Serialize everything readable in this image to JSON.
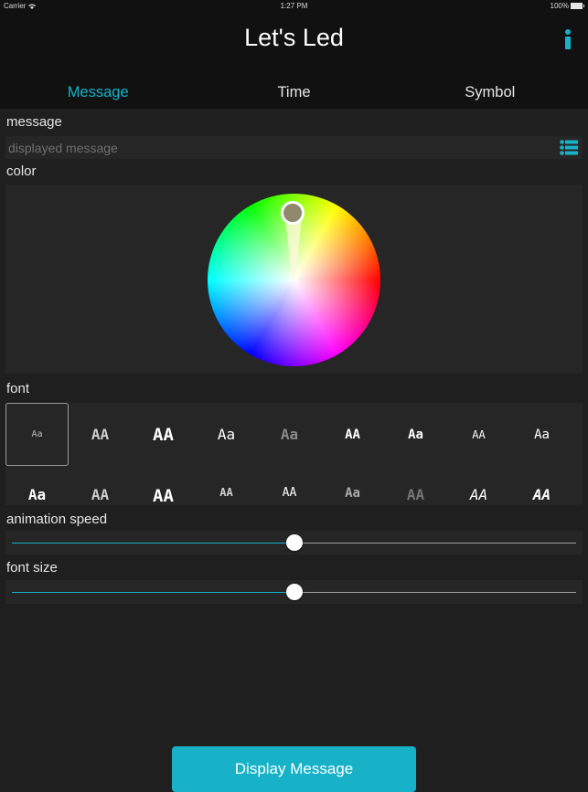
{
  "status_bar": {
    "carrier": "Carrier",
    "time": "1:27 PM",
    "battery": "100%"
  },
  "header": {
    "title": "Let's Led",
    "info_icon": "info-icon"
  },
  "tabs": [
    {
      "label": "Message",
      "active": true
    },
    {
      "label": "Time",
      "active": false
    },
    {
      "label": "Symbol",
      "active": false
    }
  ],
  "message": {
    "label": "message",
    "value": "",
    "placeholder": "displayed message",
    "list_icon": "list-icon"
  },
  "color": {
    "label": "color",
    "selected_color": "#8f8a6e"
  },
  "font": {
    "label": "font",
    "selected_index": 0,
    "row1": [
      "Aa",
      "AA",
      "AA",
      "Aa",
      "Aa",
      "AA",
      "Aa",
      "AA",
      "Aa"
    ],
    "row2": [
      "Aa",
      "AA",
      "AA",
      "AA",
      "AA",
      "Aa",
      "AA",
      "AA",
      "AA"
    ]
  },
  "animation_speed": {
    "label": "animation speed",
    "value_percent": 50
  },
  "font_size": {
    "label": "font size",
    "value_percent": 50
  },
  "display_button": {
    "label": "Display Message"
  },
  "colors": {
    "accent": "#17b2c8",
    "background": "#1f1f1f",
    "panel": "#262626",
    "header": "#111111"
  }
}
